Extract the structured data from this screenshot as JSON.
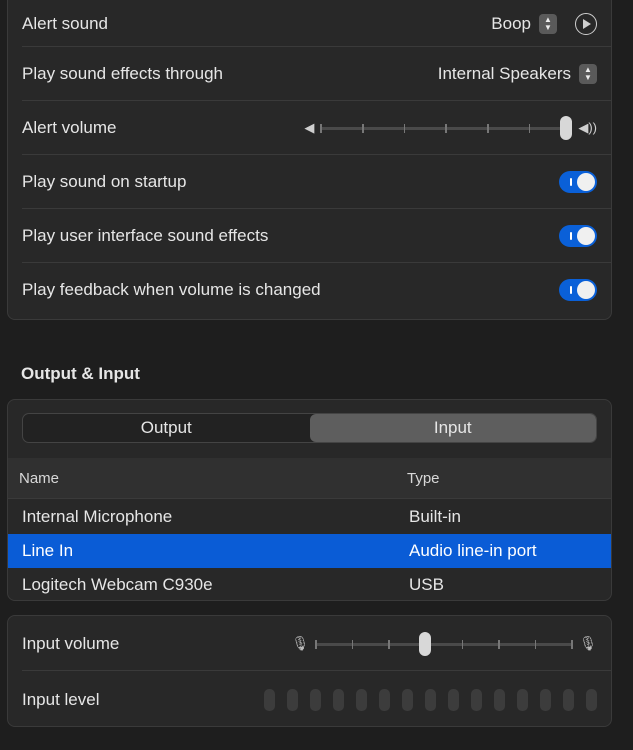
{
  "sound_settings": {
    "alert_sound": {
      "label": "Alert sound",
      "value": "Boop"
    },
    "play_through": {
      "label": "Play sound effects through",
      "value": "Internal Speakers"
    },
    "alert_volume": {
      "label": "Alert volume",
      "level": 1.0
    },
    "startup": {
      "label": "Play sound on startup",
      "on": true
    },
    "ui_effects": {
      "label": "Play user interface sound effects",
      "on": true
    },
    "feedback": {
      "label": "Play feedback when volume is changed",
      "on": true
    }
  },
  "output_input": {
    "title": "Output & Input",
    "tabs": [
      {
        "label": "Output",
        "active": false
      },
      {
        "label": "Input",
        "active": true
      }
    ],
    "columns": {
      "name": "Name",
      "type": "Type"
    },
    "devices": [
      {
        "name": "Internal Microphone",
        "type": "Built-in",
        "selected": false
      },
      {
        "name": "Line In",
        "type": "Audio line-in port",
        "selected": true
      },
      {
        "name": "Logitech Webcam C930e",
        "type": "USB",
        "selected": false
      }
    ]
  },
  "input": {
    "volume_label": "Input volume",
    "volume_level": 0.42,
    "level_label": "Input level",
    "level_segments": 15,
    "level_active": 0
  },
  "colors": {
    "accent": "#0a60d8",
    "selected_row": "#0a5cd6"
  }
}
